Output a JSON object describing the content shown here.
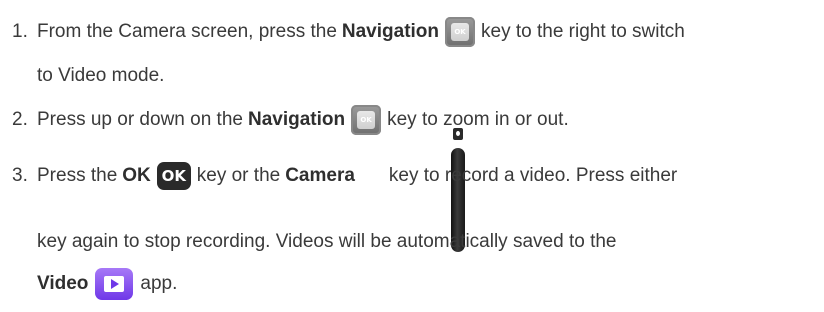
{
  "steps": [
    {
      "num": "1.",
      "pre": "From the Camera screen, press the",
      "bold": "Navigation",
      "post": "key to the right to switch",
      "cont": "to Video mode."
    },
    {
      "num": "2.",
      "pre": "Press up or down on the",
      "bold": "Navigation",
      "post": "key to zoom in or out."
    },
    {
      "num": "3.",
      "pre": "Press the",
      "bold1": "OK",
      "ok_icon_label": "OK",
      "mid": "key or the",
      "bold2": "Camera",
      "post": "key to record a video. Press either",
      "cont": "key again to stop recording. Videos will be automatically saved to the",
      "bold3": "Video",
      "end": "app."
    }
  ],
  "icons": {
    "navigation_key_label": "OK",
    "camera_key": "camera-side-key-icon",
    "video_app": "video-app-icon"
  }
}
